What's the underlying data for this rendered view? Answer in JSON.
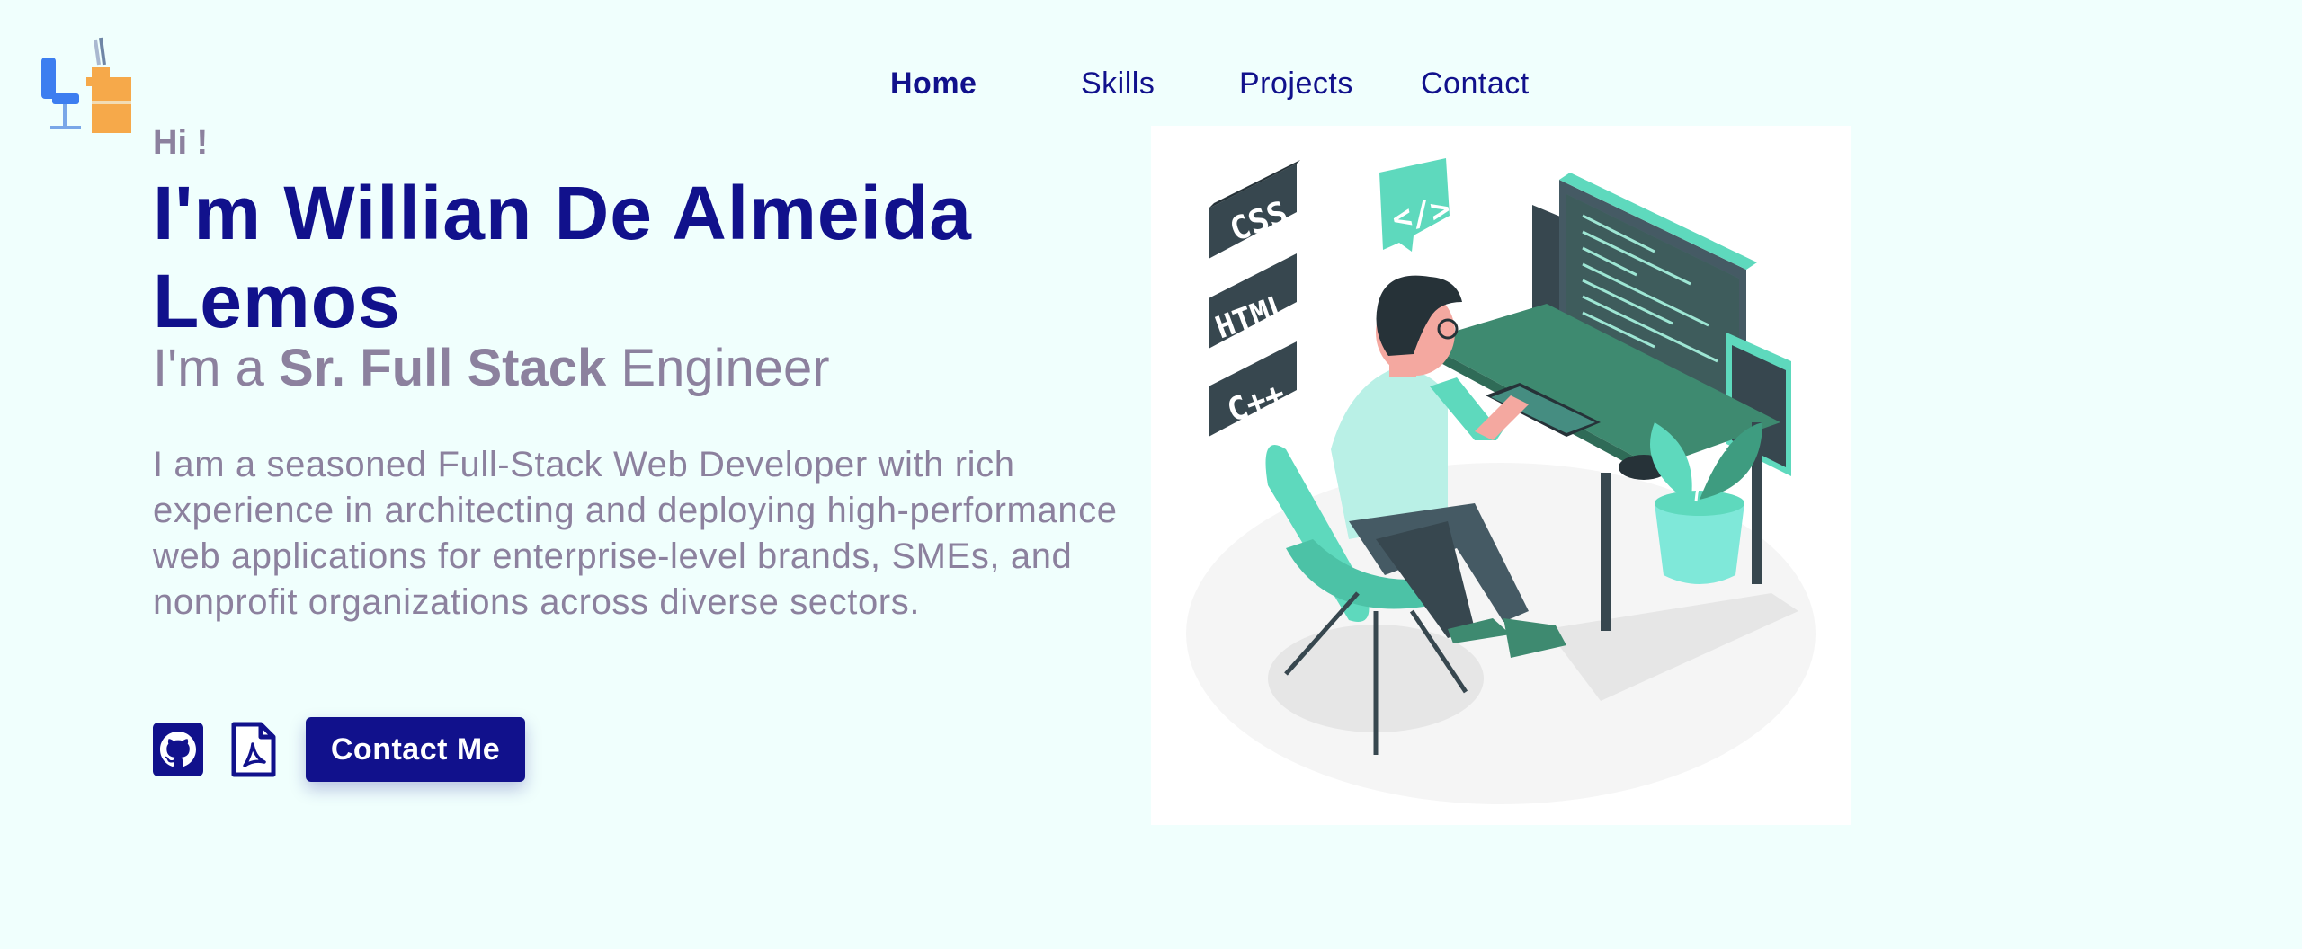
{
  "logo": {
    "icon": "desk-chair-logo-icon"
  },
  "nav": {
    "items": [
      {
        "label": "Home",
        "active": true
      },
      {
        "label": "Skills",
        "active": false
      },
      {
        "label": "Projects",
        "active": false
      },
      {
        "label": "Contact",
        "active": false
      }
    ]
  },
  "hero": {
    "greeting": "Hi !",
    "name": "I'm Willian De Almeida Lemos",
    "role_prefix": "I'm a ",
    "role_highlight": "Sr. Full Stack",
    "role_suffix": " Engineer",
    "description": "I am a seasoned Full-Stack Web Developer with rich experience in architecting and deploying high-performance web applications for enterprise-level brands, SMEs, and nonprofit organizations across diverse sectors.",
    "github_icon": "github-icon",
    "resume_icon": "pdf-file-icon",
    "contact_button": "Contact Me"
  },
  "illustration": {
    "icon": "developer-at-desk-illustration",
    "badges": [
      "CSS",
      "HTML",
      "C++",
      "</>"
    ]
  },
  "colors": {
    "background": "#f0fffd",
    "primary": "#11118c",
    "muted": "#8c819e",
    "accent": "#5ed9bd",
    "logo_orange": "#f6a94a",
    "logo_blue": "#3d7ef0"
  }
}
